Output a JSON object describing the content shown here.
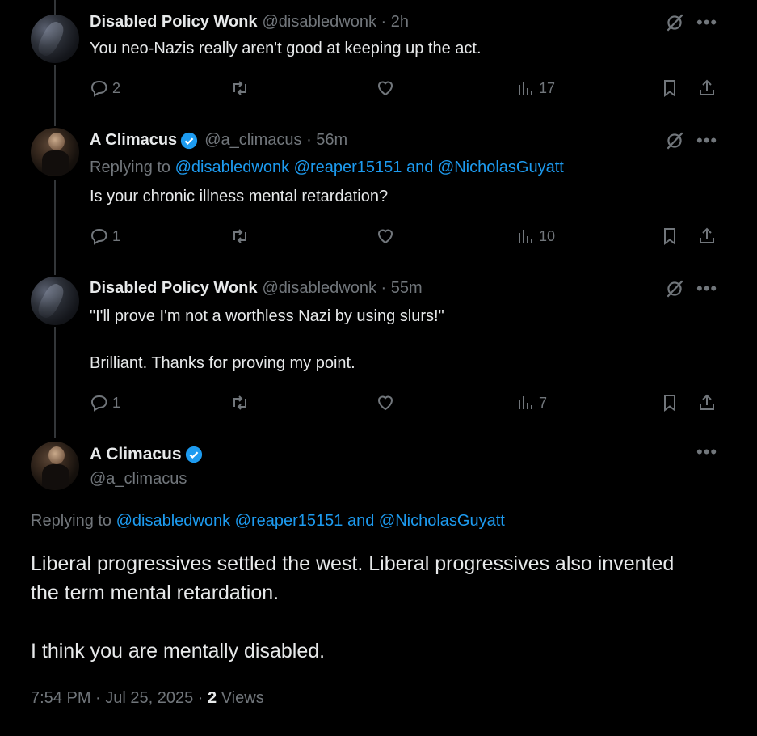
{
  "tweets": [
    {
      "name": "Disabled Policy Wonk",
      "handle": "@disabledwonk · 2h",
      "text": "You neo-Nazis really aren't good at keeping up the act.",
      "replies": "2",
      "views": "17"
    },
    {
      "name": "A Climacus",
      "handle": "@a_climacus · 56m",
      "replying_prefix": "Replying to",
      "replying_links": "@disabledwonk @reaper15151 and @NicholasGuyatt",
      "text": "Is your chronic illness mental retardation?",
      "replies": "1",
      "views": "10"
    },
    {
      "name": "Disabled Policy Wonk",
      "handle": "@disabledwonk · 55m",
      "text": "\"I'll prove I'm not a worthless Nazi by using slurs!\"\n\nBrilliant. Thanks for proving my point.",
      "replies": "1",
      "views": "7"
    }
  ],
  "main": {
    "name": "A Climacus",
    "handle": "@a_climacus",
    "replying_prefix": "Replying to",
    "replying_links": "@disabledwonk @reaper15151 and @NicholasGuyatt",
    "text": "Liberal progressives settled the west. Liberal progressives also invented\nthe term mental retardation.\n\nI think you are mentally disabled.",
    "time": "7:54 PM · Jul 25, 2025 · ",
    "views_count": "2",
    "views_label": "Views"
  },
  "icons": {
    "reply": "reply-icon",
    "retweet": "retweet-icon",
    "like": "like-icon",
    "views": "views-icon",
    "bookmark": "bookmark-icon",
    "share": "share-icon",
    "grok": "grok-icon",
    "more": "more-icon",
    "verified": "verified-badge-icon"
  },
  "colors": {
    "background": "#000000",
    "text": "#e7e9ea",
    "muted": "#71767b",
    "link": "#1d9bf0",
    "verified": "#1d9bf0"
  }
}
